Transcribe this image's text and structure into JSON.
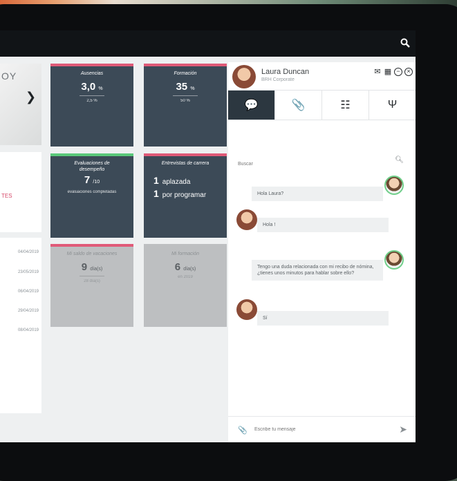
{
  "hero": {
    "title": "OY"
  },
  "left_list": {
    "status": "TES",
    "dates": [
      "04/04/2019",
      "23/05/2019",
      "06/04/2019",
      "29/04/2019",
      "08/04/2019"
    ]
  },
  "tiles": {
    "ausencias": {
      "title": "Ausencias",
      "value": "3,0",
      "unit": "%",
      "sub": "2,5 %"
    },
    "formacion": {
      "title": "Formación",
      "value": "35",
      "unit": "%",
      "sub": "50 %"
    },
    "evaluaciones": {
      "title": "Evaluaciones de desempeño",
      "value": "7",
      "unit": "/10",
      "sub": "evaluaciones completadas"
    },
    "entrevistas": {
      "title": "Entrevistas de carrera",
      "line1_num": "1",
      "line1_text": "aplazada",
      "line2_num": "1",
      "line2_text": "por programar"
    },
    "vacaciones": {
      "title": "Mi saldo de vacaciones",
      "value": "9",
      "unit": "día(s)",
      "sub": "28 día(s)"
    },
    "formacion2": {
      "title": "Mi formación",
      "value": "6",
      "unit": "día(s)",
      "sub": "en 2019"
    }
  },
  "chat": {
    "name": "Laura Duncan",
    "company": "BRH Corporate",
    "search_placeholder": "Buscar",
    "messages": [
      {
        "from": "me",
        "text": "Hola Laura?"
      },
      {
        "from": "laura",
        "text": "Hola !"
      },
      {
        "from": "me",
        "text": "Tengo una duda relacionada con mi recibo de nómina, ¿tienes unos minutos para hablar sobre ello?"
      },
      {
        "from": "laura",
        "text": "Sí"
      }
    ],
    "composer_placeholder": "Escribe tu mensaje"
  },
  "colors": {
    "pink": "#e05a78",
    "green": "#5bc97a",
    "tile_dark": "#3c4a57",
    "tile_grey": "#bdbfc1"
  }
}
